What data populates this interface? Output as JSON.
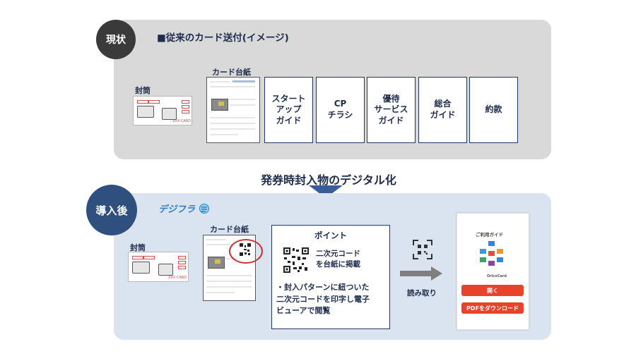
{
  "current": {
    "badge": "現状",
    "title": "■従来のカード送付(イメージ)",
    "envelope_label": "封筒",
    "envelope_card_text": "XXX CARD",
    "mount_label": "カード台紙",
    "documents": [
      {
        "lines": [
          "スタート",
          "アップ",
          "ガイド"
        ]
      },
      {
        "lines": [
          "CP",
          "チラシ"
        ]
      },
      {
        "lines": [
          "優待",
          "サービス",
          "ガイド"
        ]
      },
      {
        "lines": [
          "総合",
          "ガイド"
        ]
      },
      {
        "lines": [
          "約款"
        ]
      }
    ]
  },
  "transition": {
    "title": "発券時封入物のデジタル化"
  },
  "after": {
    "badge": "導入後",
    "logo_text": "デジフラ",
    "envelope_label": "封筒",
    "envelope_card_text": "XXX CARD",
    "mount_label": "カード台紙",
    "point": {
      "heading": "ポイント",
      "qr_lines": [
        "二次元コード",
        "を台紙に掲載"
      ],
      "body_lines": [
        "・封入パターンに紐ついた",
        "二次元コードを印字し電子",
        "ビューアで閲覧"
      ]
    },
    "scan_label": "読み取り",
    "phone": {
      "title": "ご利用ガイド",
      "brand": "OricoCard",
      "open_button": "開く",
      "pdf_button": "PDFをダウンロード"
    }
  },
  "colors": {
    "panel_current": "#d9d9d9",
    "panel_after": "#dae3f0",
    "badge_current": "#3a3a3a",
    "badge_after": "#2f4f7f",
    "arrow": "#3a5d9a",
    "highlight_red": "#d0312d",
    "button_red": "#e8422b"
  },
  "icons": [
    "qr-scan-icon",
    "arrow-right-icon",
    "arrow-down-icon",
    "qr-code-icon"
  ]
}
